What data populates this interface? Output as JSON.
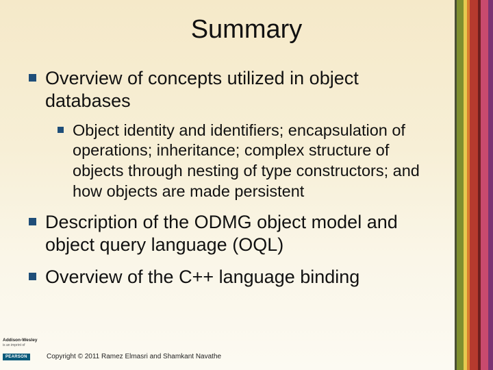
{
  "title": "Summary",
  "bullets": {
    "b1": "Overview of concepts utilized in object databases",
    "b1_sub1": "Object identity and identifiers; encapsulation of operations; inheritance; complex structure of objects through nesting of type constructors; and how objects are made persistent",
    "b2": "Description of the ODMG object model and object query language (OQL)",
    "b3": "Overview of the C++ language binding"
  },
  "logo": {
    "line1": "Addison-Wesley",
    "line2": "is an imprint of",
    "brand": "PEARSON"
  },
  "copyright": "Copyright © 2011 Ramez Elmasri and Shamkant Navathe"
}
